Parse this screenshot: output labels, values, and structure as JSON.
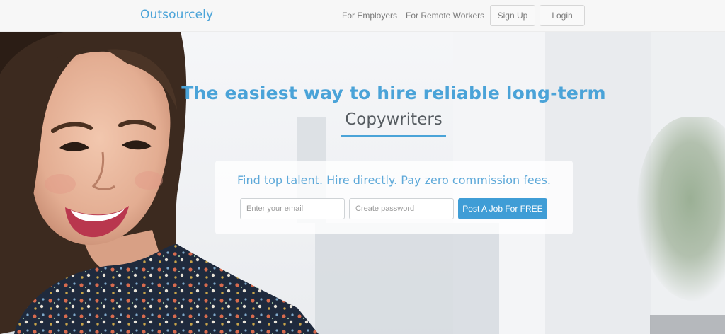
{
  "brand": {
    "name": "Outsourcely",
    "accent": "#4aa3d8",
    "button": "#3f9dd6"
  },
  "nav": {
    "links": [
      "For Employers",
      "For Remote Workers"
    ],
    "signup": "Sign Up",
    "login": "Login"
  },
  "hero": {
    "headline": "The easiest way to hire reliable long-term",
    "role": "Copywriters",
    "tagline": "Find top talent. Hire directly. Pay zero commission fees.",
    "email_placeholder": "Enter your email",
    "password_placeholder": "Create password",
    "cta": "Post A Job For FREE"
  }
}
